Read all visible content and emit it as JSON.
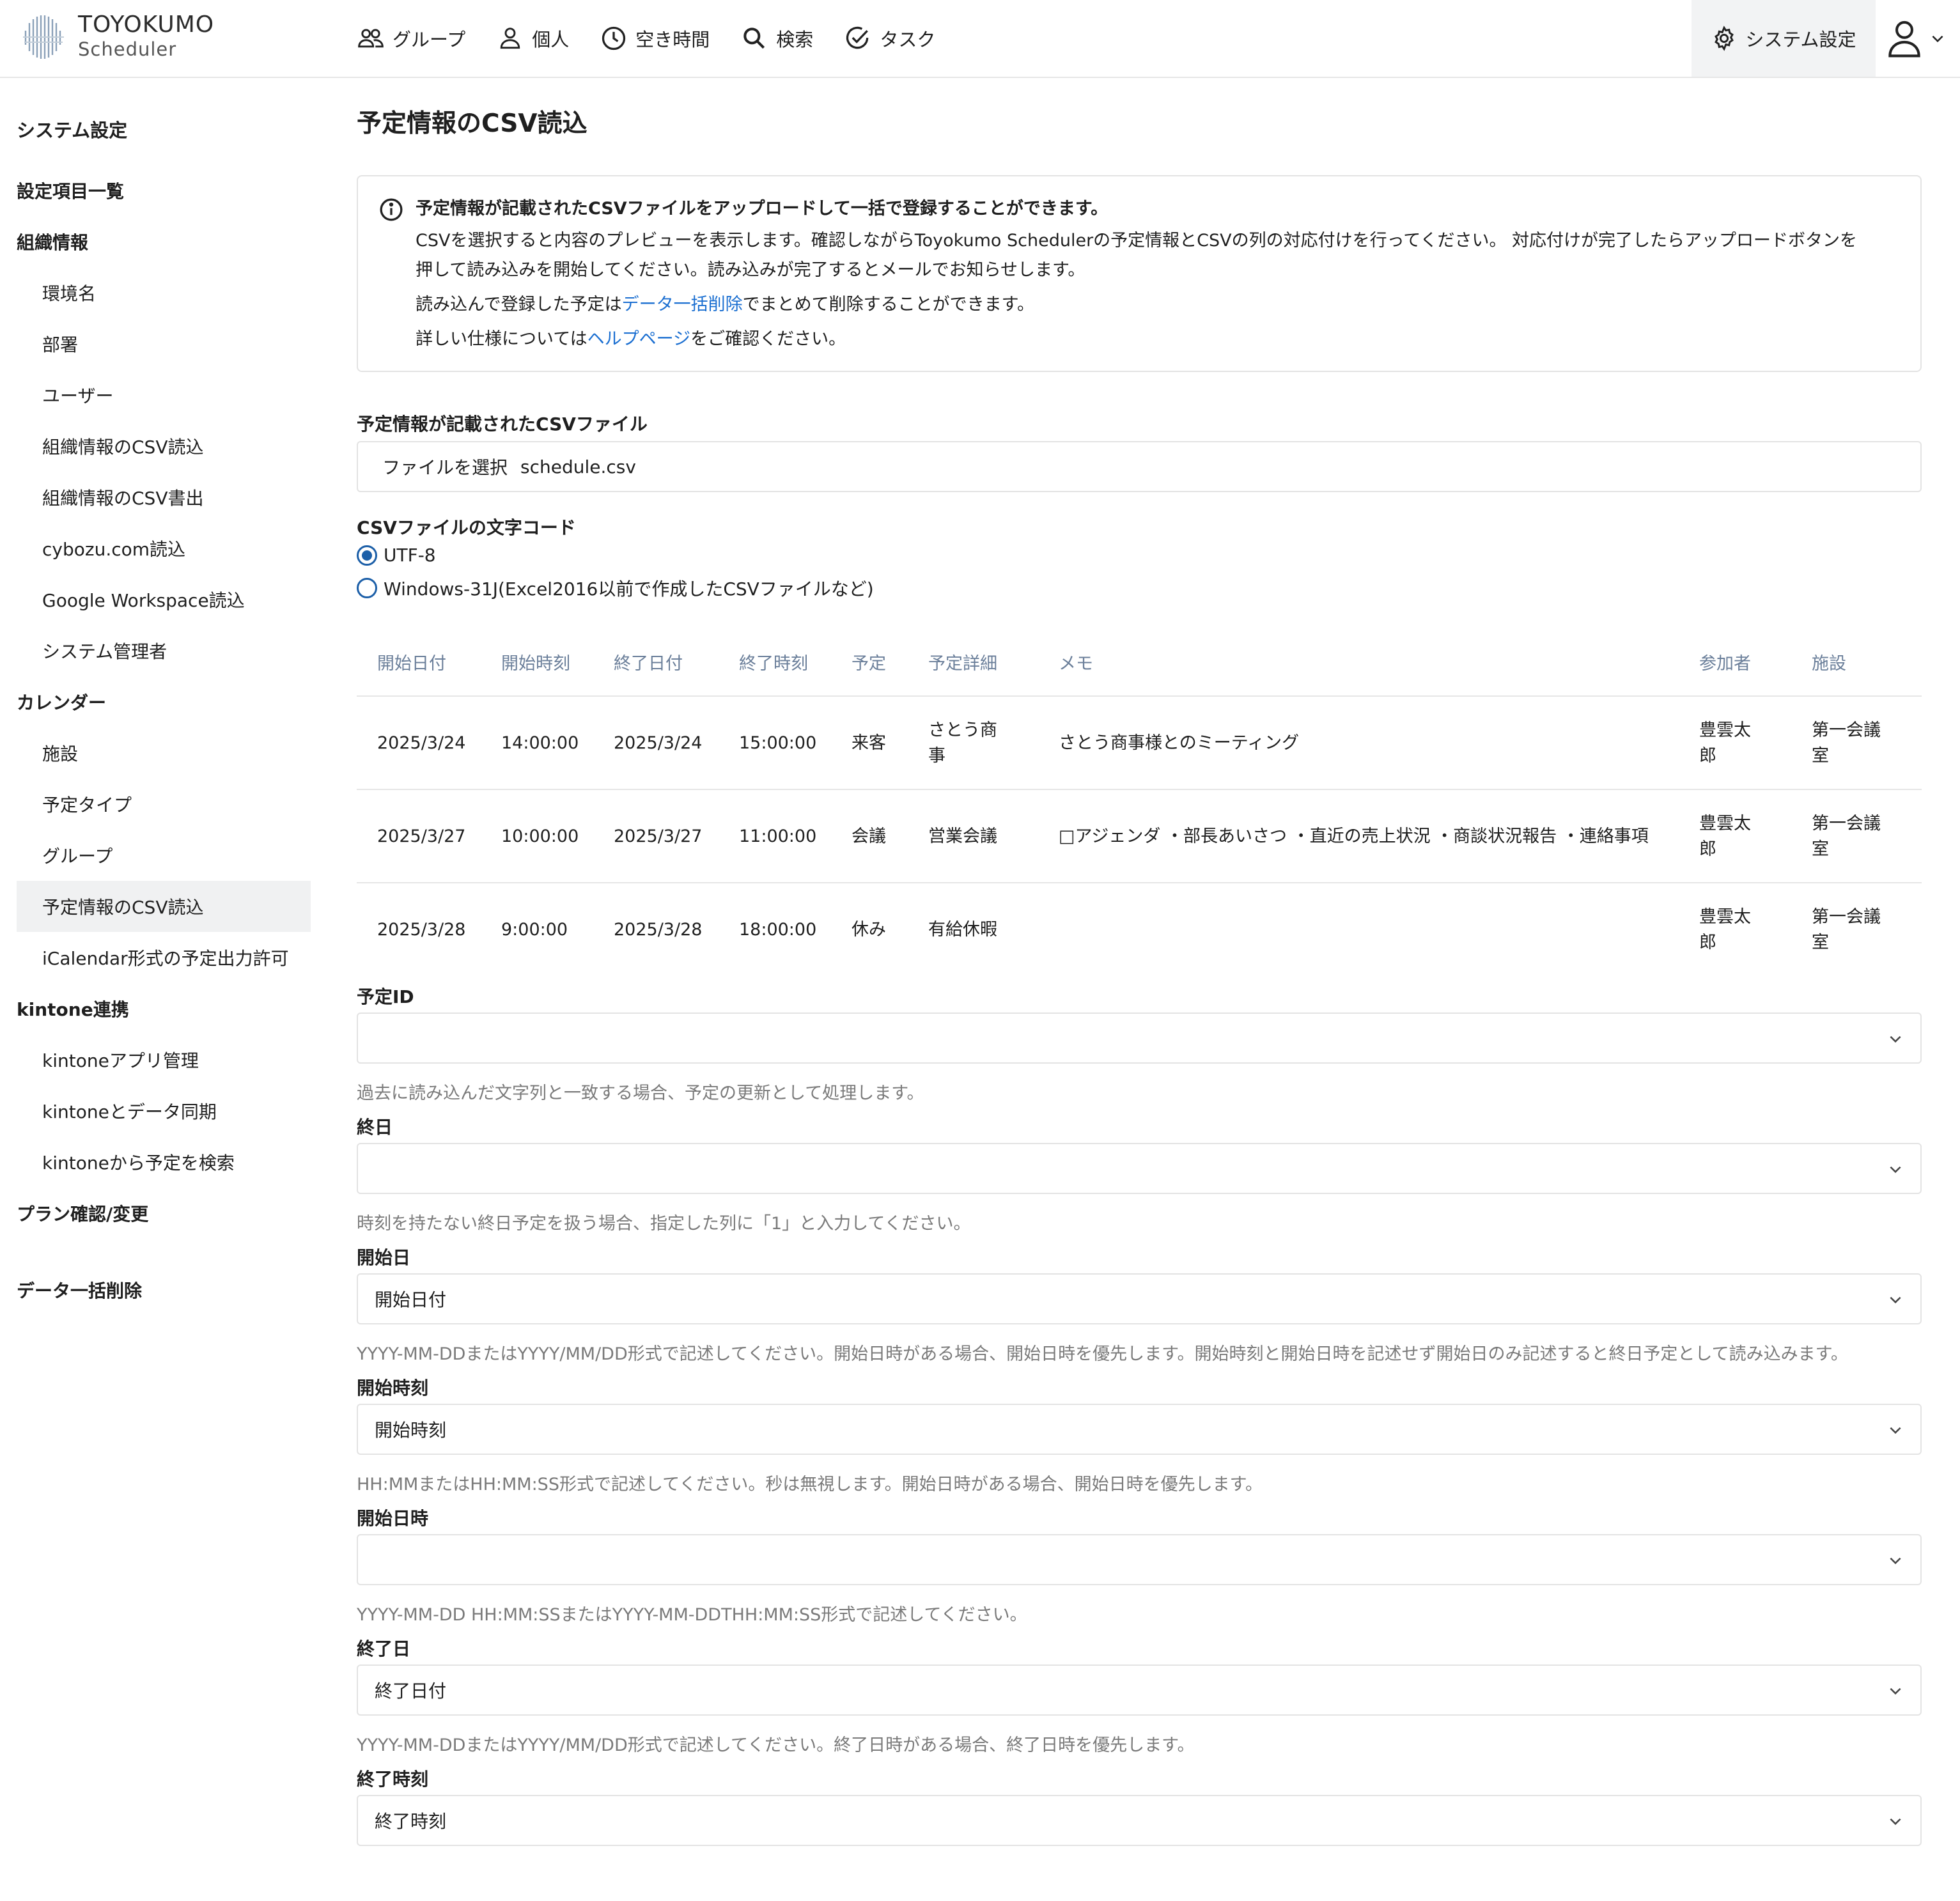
{
  "app": {
    "logo_title": "TOYOKUMO",
    "logo_sub": "Scheduler"
  },
  "nav": {
    "items": [
      {
        "label": "グループ",
        "icon": "group-icon"
      },
      {
        "label": "個人",
        "icon": "person-icon"
      },
      {
        "label": "空き時間",
        "icon": "clock-icon"
      },
      {
        "label": "検索",
        "icon": "search-icon"
      },
      {
        "label": "タスク",
        "icon": "task-check-icon"
      }
    ],
    "system_settings": "システム設定"
  },
  "sidebar": {
    "title": "システム設定",
    "items": [
      {
        "label": "設定項目一覧",
        "level": "head"
      },
      {
        "label": "組織情報",
        "level": "head"
      },
      {
        "label": "環境名",
        "level": "sub"
      },
      {
        "label": "部署",
        "level": "sub"
      },
      {
        "label": "ユーザー",
        "level": "sub"
      },
      {
        "label": "組織情報のCSV読込",
        "level": "sub"
      },
      {
        "label": "組織情報のCSV書出",
        "level": "sub"
      },
      {
        "label": "cybozu.com読込",
        "level": "sub"
      },
      {
        "label": "Google Workspace読込",
        "level": "sub"
      },
      {
        "label": "システム管理者",
        "level": "sub"
      },
      {
        "label": "カレンダー",
        "level": "head"
      },
      {
        "label": "施設",
        "level": "sub"
      },
      {
        "label": "予定タイプ",
        "level": "sub"
      },
      {
        "label": "グループ",
        "level": "sub"
      },
      {
        "label": "予定情報のCSV読込",
        "level": "sub",
        "active": true
      },
      {
        "label": "iCalendar形式の予定出力許可",
        "level": "sub"
      },
      {
        "label": "kintone連携",
        "level": "head"
      },
      {
        "label": "kintoneアプリ管理",
        "level": "sub"
      },
      {
        "label": "kintoneとデータ同期",
        "level": "sub"
      },
      {
        "label": "kintoneから予定を検索",
        "level": "sub"
      },
      {
        "label": "プラン確認/変更",
        "level": "head"
      },
      {
        "label": "データ一括削除",
        "level": "head"
      }
    ]
  },
  "main": {
    "title": "予定情報のCSV読込",
    "info": {
      "line1": "予定情報が記載されたCSVファイルをアップロードして一括で登録することができます。",
      "line2": "CSVを選択すると内容のプレビューを表示します。確認しながらToyokumo Schedulerの予定情報とCSVの列の対応付けを行ってください。 対応付けが完了したらアップロードボタンを",
      "line3": "押して読み込みを開始してください。読み込みが完了するとメールでお知らせします。",
      "line4_pre": "読み込んで登録した予定は",
      "line4_link": "データ一括削除",
      "line4_post": "でまとめて削除することができます。",
      "line5_pre": "詳しい仕様については",
      "line5_link": "ヘルプページ",
      "line5_post": "をご確認ください。"
    },
    "file": {
      "label": "予定情報が記載されたCSVファイル",
      "button": "ファイルを選択",
      "name": "schedule.csv"
    },
    "encoding": {
      "label": "CSVファイルの文字コード",
      "options": [
        {
          "label": "UTF-8",
          "checked": true
        },
        {
          "label": "Windows-31J(Excel2016以前で作成したCSVファイルなど)",
          "checked": false
        }
      ]
    },
    "table": {
      "headers": [
        "開始日付",
        "開始時刻",
        "終了日付",
        "終了時刻",
        "予定",
        "予定詳細",
        "メモ",
        "参加者",
        "施設"
      ],
      "rows": [
        [
          "2025/3/24",
          "14:00:00",
          "2025/3/24",
          "15:00:00",
          "来客",
          "さとう商事",
          "さとう商事様とのミーティング",
          "豊雲太郎",
          "第一会議室"
        ],
        [
          "2025/3/27",
          "10:00:00",
          "2025/3/27",
          "11:00:00",
          "会議",
          "営業会議",
          "□アジェンダ ・部長あいさつ ・直近の売上状況 ・商談状況報告 ・連絡事項",
          "豊雲太郎",
          "第一会議室"
        ],
        [
          "2025/3/28",
          "9:00:00",
          "2025/3/28",
          "18:00:00",
          "休み",
          "有給休暇",
          "",
          "豊雲太郎",
          "第一会議室"
        ]
      ]
    },
    "fields": [
      {
        "label": "予定ID",
        "value": "",
        "hint": "過去に読み込んだ文字列と一致する場合、予定の更新として処理します。"
      },
      {
        "label": "終日",
        "value": "",
        "hint": "時刻を持たない終日予定を扱う場合、指定した列に「1」と入力してください。"
      },
      {
        "label": "開始日",
        "value": "開始日付",
        "hint": "YYYY-MM-DDまたはYYYY/MM/DD形式で記述してください。開始日時がある場合、開始日時を優先します。開始時刻と開始日時を記述せず開始日のみ記述すると終日予定として読み込みます。"
      },
      {
        "label": "開始時刻",
        "value": "開始時刻",
        "hint": "HH:MMまたはHH:MM:SS形式で記述してください。秒は無視します。開始日時がある場合、開始日時を優先します。"
      },
      {
        "label": "開始日時",
        "value": "",
        "hint": "YYYY-MM-DD HH:MM:SSまたはYYYY-MM-DDTHH:MM:SS形式で記述してください。"
      },
      {
        "label": "終了日",
        "value": "終了日付",
        "hint": "YYYY-MM-DDまたはYYYY/MM/DD形式で記述してください。終了日時がある場合、終了日時を優先します。"
      },
      {
        "label": "終了時刻",
        "value": "終了時刻",
        "hint": ""
      }
    ]
  }
}
